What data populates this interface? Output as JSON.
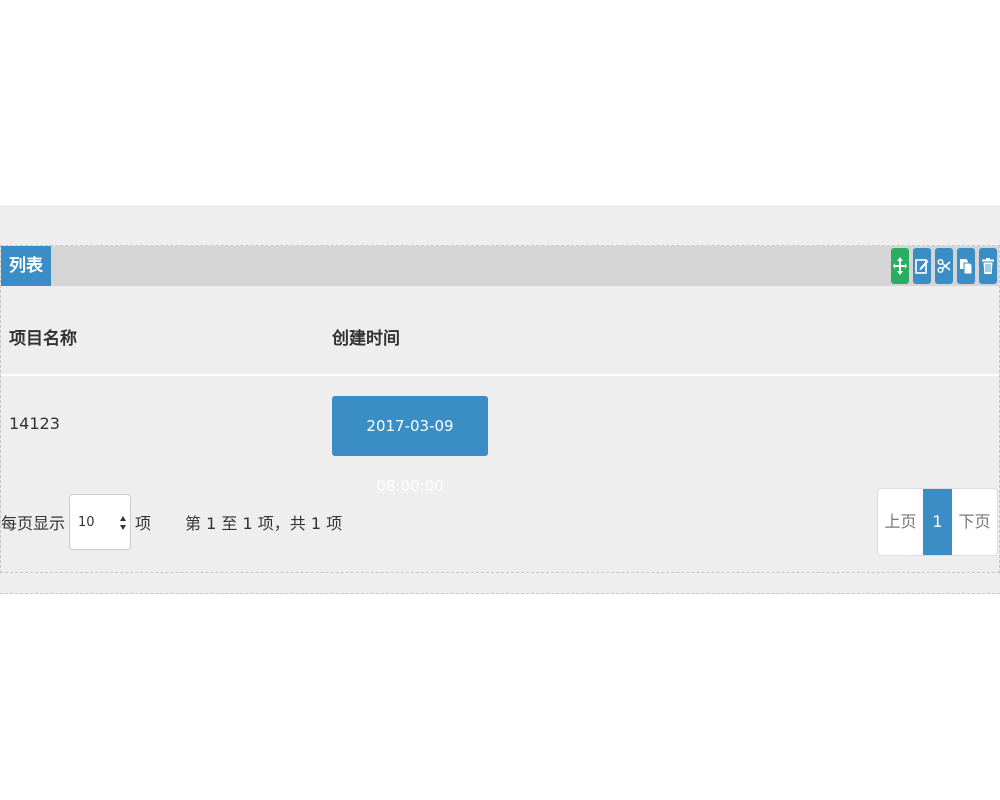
{
  "panel": {
    "title": "列表",
    "toolbar": [
      {
        "icon": "move-icon",
        "color": "#27ae60"
      },
      {
        "icon": "edit-icon",
        "color": "#3a8dc5"
      },
      {
        "icon": "scissors-icon",
        "color": "#3a8dc5"
      },
      {
        "icon": "copy-icon",
        "color": "#3a8dc5"
      },
      {
        "icon": "trash-icon",
        "color": "#3a8dc5"
      }
    ]
  },
  "table": {
    "headers": [
      "项目名称",
      "创建时间"
    ],
    "rows": [
      {
        "name": "14123",
        "created": "2017-03-09 08:00:00"
      }
    ]
  },
  "footer": {
    "per_page_prefix": "每页显示",
    "per_page_value": "10",
    "per_page_suffix": "项",
    "info": "第 1 至 1 项，共 1 项"
  },
  "pagination": {
    "prev": "上页",
    "current": "1",
    "next": "下页"
  },
  "colors": {
    "accent": "#3a8dc5",
    "success": "#27ae60"
  }
}
